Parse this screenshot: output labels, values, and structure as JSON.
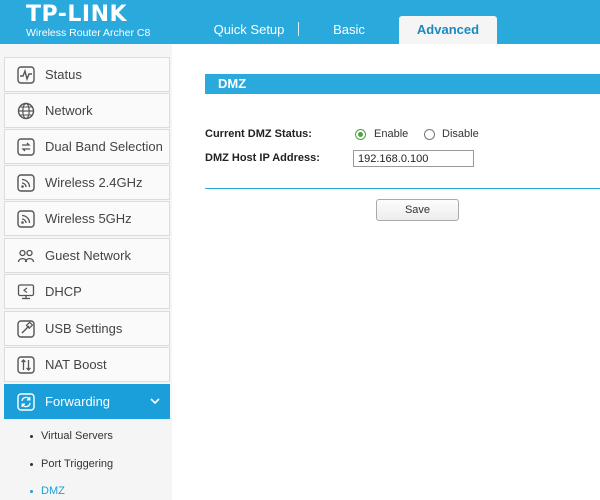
{
  "header": {
    "logo": "TP-LINK",
    "subtitle": "Wireless Router Archer C8",
    "tabs": [
      {
        "label": "Quick Setup"
      },
      {
        "label": "Basic"
      },
      {
        "label": "Advanced",
        "active": true
      }
    ]
  },
  "sidebar": {
    "items": [
      {
        "label": "Status",
        "icon": "status-icon"
      },
      {
        "label": "Network",
        "icon": "globe-icon"
      },
      {
        "label": "Dual Band Selection",
        "icon": "dual-band-icon"
      },
      {
        "label": "Wireless 2.4GHz",
        "icon": "wireless-icon"
      },
      {
        "label": "Wireless 5GHz",
        "icon": "wireless-icon"
      },
      {
        "label": "Guest Network",
        "icon": "guest-users-icon"
      },
      {
        "label": "DHCP",
        "icon": "dhcp-monitor-icon"
      },
      {
        "label": "USB Settings",
        "icon": "usb-icon"
      },
      {
        "label": "NAT Boost",
        "icon": "nat-boost-icon"
      },
      {
        "label": "Forwarding",
        "icon": "forwarding-icon",
        "active": true
      }
    ],
    "sub_items": [
      {
        "label": "Virtual Servers"
      },
      {
        "label": "Port Triggering"
      },
      {
        "label": "DMZ",
        "active": true
      }
    ]
  },
  "main": {
    "section_title": "DMZ",
    "dmz_status_label": "Current DMZ Status:",
    "enable_label": "Enable",
    "disable_label": "Disable",
    "dmz_status_value": "Enable",
    "host_ip_label": "DMZ Host IP Address:",
    "host_ip_value": "192.168.0.100",
    "save_label": "Save"
  },
  "colors": {
    "header_blue": "#2aa9dd",
    "active_blue": "#1a9fdb",
    "radio_green": "#4da53a",
    "sidebar_bg": "#f5f5f5"
  }
}
